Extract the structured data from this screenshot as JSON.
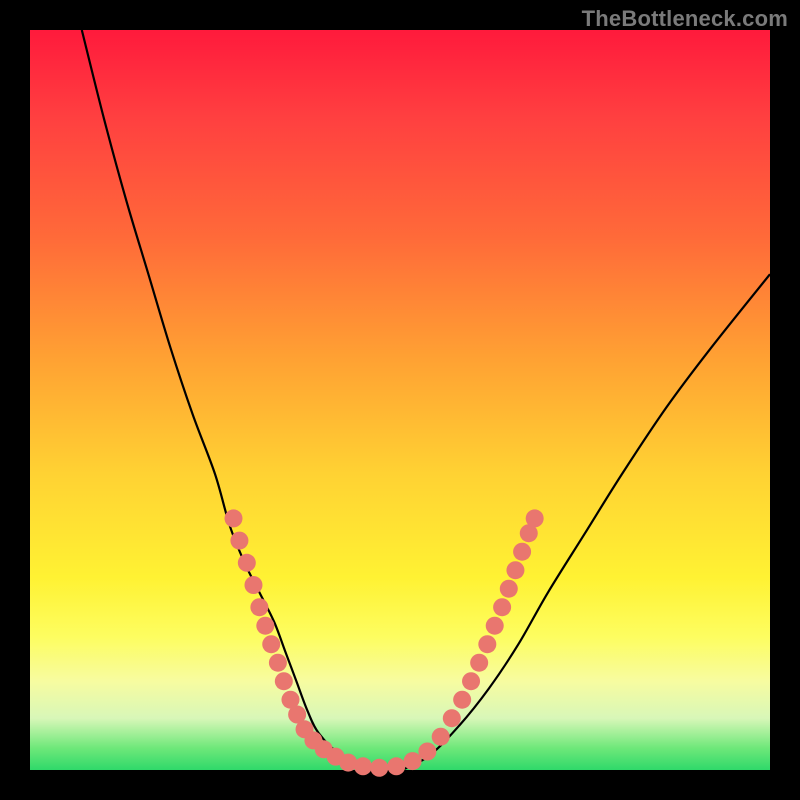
{
  "watermark": "TheBottleneck.com",
  "chart_data": {
    "type": "line",
    "title": "",
    "xlabel": "",
    "ylabel": "",
    "xlim": [
      0,
      100
    ],
    "ylim": [
      0,
      100
    ],
    "grid": false,
    "legend": false,
    "series": [
      {
        "name": "bottleneck-curve",
        "x": [
          7,
          10,
          13,
          16,
          19,
          22,
          25,
          27,
          29,
          31,
          33,
          34.5,
          36,
          37.5,
          39,
          42,
          46,
          50,
          54,
          58,
          62,
          66,
          70,
          75,
          80,
          86,
          92,
          100
        ],
        "y": [
          100,
          88,
          77,
          67,
          57,
          48,
          40,
          33,
          28,
          24,
          20,
          16,
          12,
          8,
          5,
          2,
          0,
          0,
          2,
          6,
          11,
          17,
          24,
          32,
          40,
          49,
          57,
          67
        ]
      }
    ],
    "markers": [
      {
        "x": 27.5,
        "y": 34
      },
      {
        "x": 28.3,
        "y": 31
      },
      {
        "x": 29.3,
        "y": 28
      },
      {
        "x": 30.2,
        "y": 25
      },
      {
        "x": 31.0,
        "y": 22
      },
      {
        "x": 31.8,
        "y": 19.5
      },
      {
        "x": 32.6,
        "y": 17
      },
      {
        "x": 33.5,
        "y": 14.5
      },
      {
        "x": 34.3,
        "y": 12
      },
      {
        "x": 35.2,
        "y": 9.5
      },
      {
        "x": 36.1,
        "y": 7.5
      },
      {
        "x": 37.1,
        "y": 5.5
      },
      {
        "x": 38.3,
        "y": 4
      },
      {
        "x": 39.7,
        "y": 2.8
      },
      {
        "x": 41.3,
        "y": 1.8
      },
      {
        "x": 43.0,
        "y": 1.0
      },
      {
        "x": 45.0,
        "y": 0.5
      },
      {
        "x": 47.2,
        "y": 0.3
      },
      {
        "x": 49.5,
        "y": 0.5
      },
      {
        "x": 51.7,
        "y": 1.2
      },
      {
        "x": 53.7,
        "y": 2.5
      },
      {
        "x": 55.5,
        "y": 4.5
      },
      {
        "x": 57.0,
        "y": 7
      },
      {
        "x": 58.4,
        "y": 9.5
      },
      {
        "x": 59.6,
        "y": 12
      },
      {
        "x": 60.7,
        "y": 14.5
      },
      {
        "x": 61.8,
        "y": 17
      },
      {
        "x": 62.8,
        "y": 19.5
      },
      {
        "x": 63.8,
        "y": 22
      },
      {
        "x": 64.7,
        "y": 24.5
      },
      {
        "x": 65.6,
        "y": 27
      },
      {
        "x": 66.5,
        "y": 29.5
      },
      {
        "x": 67.4,
        "y": 32
      },
      {
        "x": 68.2,
        "y": 34
      }
    ],
    "background_gradient": {
      "direction": "vertical",
      "stops": [
        {
          "pos": 0.0,
          "color": "#ff1a3c"
        },
        {
          "pos": 0.12,
          "color": "#ff4040"
        },
        {
          "pos": 0.28,
          "color": "#ff6a39"
        },
        {
          "pos": 0.44,
          "color": "#ffa033"
        },
        {
          "pos": 0.6,
          "color": "#ffd233"
        },
        {
          "pos": 0.74,
          "color": "#fff233"
        },
        {
          "pos": 0.82,
          "color": "#fdfd60"
        },
        {
          "pos": 0.88,
          "color": "#f7fca0"
        },
        {
          "pos": 0.93,
          "color": "#d8f7b8"
        },
        {
          "pos": 0.97,
          "color": "#6fe87a"
        },
        {
          "pos": 1.0,
          "color": "#2fd96a"
        }
      ]
    },
    "marker_radius": 9,
    "curve_color": "#000000"
  }
}
